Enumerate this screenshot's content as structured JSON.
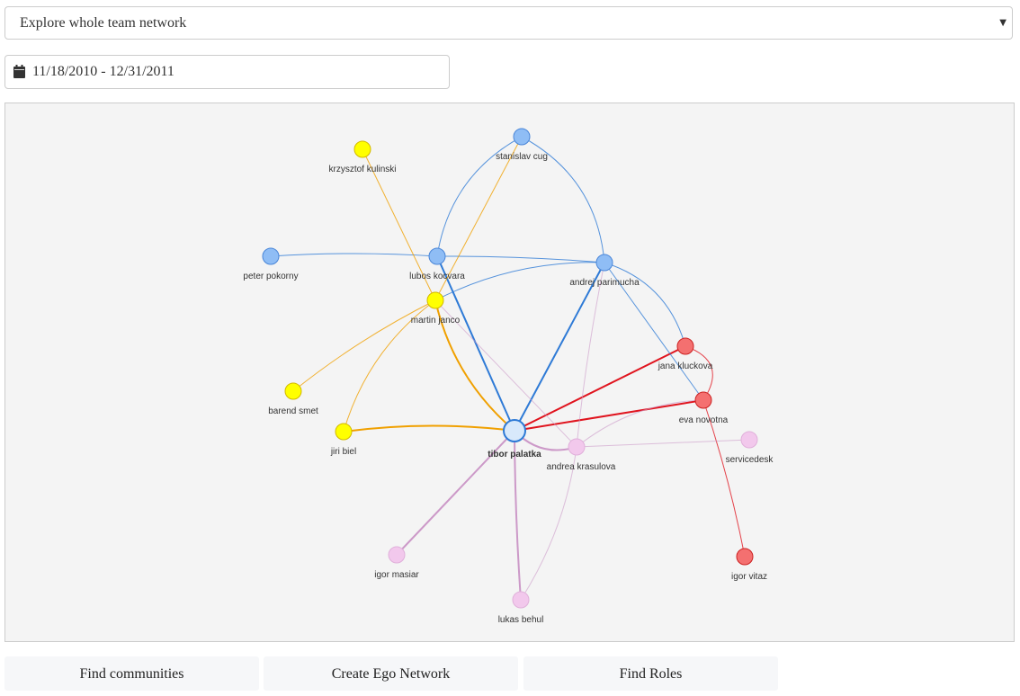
{
  "view_select": {
    "selected": "Explore whole team network",
    "arrow_icon": "caret-down-icon"
  },
  "date_range": {
    "icon": "calendar-icon",
    "value": "11/18/2010 - 12/31/2011"
  },
  "network": {
    "colors": {
      "blue_fill": "#8fbdf5",
      "blue_stroke": "#4a86d8",
      "blue_edge": "#2e7ad6",
      "yellow_fill": "#ffff00",
      "yellow_stroke": "#d2b800",
      "yellow_edge": "#f0a000",
      "red_fill": "#f47070",
      "red_stroke": "#cc2222",
      "red_edge": "#e0141e",
      "pink_fill": "#f2c8ec",
      "pink_stroke": "#e0b0da",
      "pink_edge": "#cc99c8",
      "center_fill": "#d8e9fb",
      "center_stroke": "#2e7ad6"
    },
    "nodes": [
      {
        "id": "stanislav",
        "label": "stanislav cug",
        "group": "blue"
      },
      {
        "id": "krzysztof",
        "label": "krzysztof kulinski",
        "group": "yellow"
      },
      {
        "id": "peter",
        "label": "peter pokorny",
        "group": "blue"
      },
      {
        "id": "lubos",
        "label": "lubos kocvara",
        "group": "blue"
      },
      {
        "id": "andrej",
        "label": "andrej parimucha",
        "group": "blue"
      },
      {
        "id": "martin",
        "label": "martin janco",
        "group": "yellow"
      },
      {
        "id": "jana",
        "label": "jana kluckova",
        "group": "red"
      },
      {
        "id": "barend",
        "label": "barend smet",
        "group": "yellow"
      },
      {
        "id": "eva",
        "label": "eva novotna",
        "group": "red"
      },
      {
        "id": "jiri",
        "label": "jiri biel",
        "group": "yellow"
      },
      {
        "id": "tibor",
        "label": "tibor palatka",
        "group": "center"
      },
      {
        "id": "andrea",
        "label": "andrea krasulova",
        "group": "pink"
      },
      {
        "id": "servicedesk",
        "label": "servicedesk",
        "group": "pink"
      },
      {
        "id": "igorm",
        "label": "igor masiar",
        "group": "pink"
      },
      {
        "id": "igorv",
        "label": "igor vitaz",
        "group": "red"
      },
      {
        "id": "lukas",
        "label": "lukas behul",
        "group": "pink"
      }
    ],
    "edges": [
      {
        "source": "tibor",
        "target": "lubos",
        "group": "blue",
        "weight": "strong"
      },
      {
        "source": "tibor",
        "target": "andrej",
        "group": "blue",
        "weight": "strong"
      },
      {
        "source": "tibor",
        "target": "jana",
        "group": "red",
        "weight": "strong"
      },
      {
        "source": "tibor",
        "target": "eva",
        "group": "red",
        "weight": "strong"
      },
      {
        "source": "tibor",
        "target": "martin",
        "group": "yellow",
        "weight": "strong"
      },
      {
        "source": "tibor",
        "target": "jiri",
        "group": "yellow",
        "weight": "strong"
      },
      {
        "source": "tibor",
        "target": "igorm",
        "group": "pink",
        "weight": "strong"
      },
      {
        "source": "tibor",
        "target": "lukas",
        "group": "pink",
        "weight": "strong"
      },
      {
        "source": "tibor",
        "target": "andrea",
        "group": "pink",
        "weight": "strong"
      },
      {
        "source": "lubos",
        "target": "stanislav",
        "group": "blue",
        "weight": "light"
      },
      {
        "source": "stanislav",
        "target": "andrej",
        "group": "blue",
        "weight": "light"
      },
      {
        "source": "peter",
        "target": "lubos",
        "group": "blue",
        "weight": "light"
      },
      {
        "source": "lubos",
        "target": "andrej",
        "group": "blue",
        "weight": "light"
      },
      {
        "source": "martin",
        "target": "andrej",
        "group": "blue",
        "weight": "light"
      },
      {
        "source": "andrej",
        "target": "jana",
        "group": "blue",
        "weight": "light"
      },
      {
        "source": "andrej",
        "target": "eva",
        "group": "blue",
        "weight": "light"
      },
      {
        "source": "jana",
        "target": "eva",
        "group": "red",
        "weight": "light"
      },
      {
        "source": "eva",
        "target": "igorv",
        "group": "red",
        "weight": "light"
      },
      {
        "source": "krzysztof",
        "target": "martin",
        "group": "yellow",
        "weight": "light"
      },
      {
        "source": "martin",
        "target": "stanislav",
        "group": "yellow",
        "weight": "light"
      },
      {
        "source": "martin",
        "target": "barend",
        "group": "yellow",
        "weight": "light"
      },
      {
        "source": "martin",
        "target": "jiri",
        "group": "yellow",
        "weight": "light"
      },
      {
        "source": "martin",
        "target": "andrea",
        "group": "pink",
        "weight": "light"
      },
      {
        "source": "andrea",
        "target": "servicedesk",
        "group": "pink",
        "weight": "light"
      },
      {
        "source": "andrea",
        "target": "eva",
        "group": "pink",
        "weight": "light"
      },
      {
        "source": "andrea",
        "target": "andrej",
        "group": "pink",
        "weight": "light"
      },
      {
        "source": "andrea",
        "target": "lukas",
        "group": "pink",
        "weight": "light"
      }
    ]
  },
  "buttons": {
    "find_communities": "Find communities",
    "create_ego": "Create Ego Network",
    "find_roles": "Find Roles"
  }
}
